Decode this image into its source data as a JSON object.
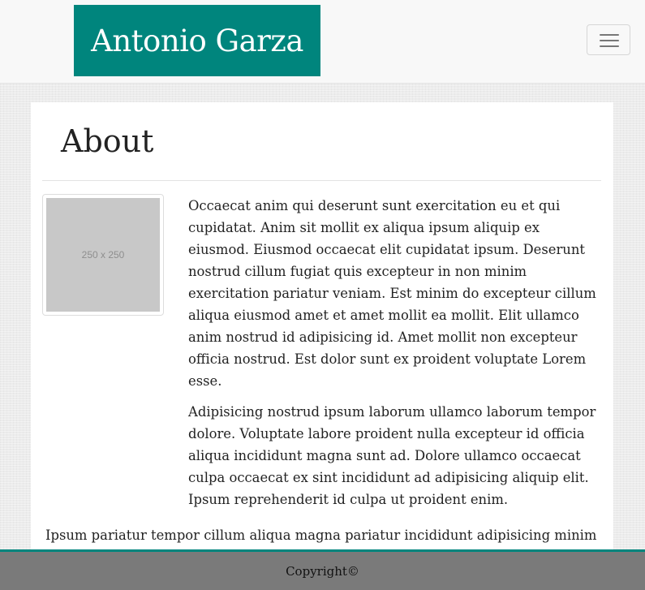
{
  "navbar": {
    "brand": "Antonio Garza",
    "menu_icon": "hamburger-menu-icon"
  },
  "main": {
    "title": "About",
    "image_placeholder": "250 x 250",
    "paragraphs": [
      "Occaecat anim qui deserunt sunt exercitation eu et qui cupidatat. Anim sit mollit ex aliqua ipsum aliquip ex eiusmod. Eiusmod occaecat elit cupidatat ipsum. Deserunt nostrud cillum fugiat quis excepteur in non minim exercitation pariatur veniam. Est minim do excepteur cillum aliqua eiusmod amet et amet mollit ea mollit. Elit ullamco anim nostrud id adipisicing id. Amet mollit non excepteur officia nostrud. Est dolor sunt ex proident voluptate Lorem esse.",
      "Adipisicing nostrud ipsum laborum ullamco laborum tempor dolore. Voluptate labore proident nulla excepteur id officia aliqua incididunt magna sunt ad. Dolore ullamco occaecat culpa occaecat ex sint incididunt ad adipisicing aliquip elit. Ipsum reprehenderit id culpa ut proident enim.",
      "Ipsum pariatur tempor cillum aliqua magna pariatur incididunt adipisicing minim"
    ]
  },
  "footer": {
    "copyright": "Copyright©"
  },
  "colors": {
    "brand": "#00857d",
    "footer_bg": "#7a7a7a"
  }
}
